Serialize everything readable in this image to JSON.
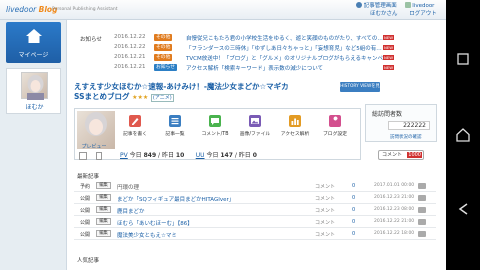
{
  "header": {
    "logo_brand": "livedoor",
    "logo_blog": "Blog",
    "tagline": "Personal Publishing Assistant",
    "link_settings": "記事管理画面",
    "link_livedoor": "livedoor",
    "user": "ほむかさん",
    "logout": "ログアウト"
  },
  "sidebar": {
    "mypage": "マイページ",
    "username": "ほむか"
  },
  "news": {
    "label": "お知らせ",
    "items": [
      {
        "date": "2016.12.22",
        "category": "その他",
        "cat_color": "#e07b1e",
        "text": "自慢従兄こもたろ君の小学校生活をゆるく、遊と笑顔のものがたり、すべての…",
        "is_new": true,
        "new_label": "NEW"
      },
      {
        "date": "2016.12.22",
        "category": "その他",
        "cat_color": "#e07b1e",
        "text": "「フランダースの三時休」「ゆずしあ日々ちゃっと」「妄想育児」など5組の有…",
        "is_new": true,
        "new_label": "NEW"
      },
      {
        "date": "2016.12.21",
        "category": "その他",
        "cat_color": "#e07b1e",
        "text": "TVCM放送中！「ブログ」と「グルメ」のオリジナルブログがもらえるキャンペ…",
        "is_new": true,
        "new_label": "NEW"
      },
      {
        "date": "2016.12.21",
        "category": "お知らせ",
        "cat_color": "#2c7fc5",
        "text": "アクセス解析「検索キーワード」表示数の減少について",
        "is_new": true,
        "new_label": "NEW"
      }
    ]
  },
  "blog": {
    "title_line1": "えすえす少女ほむか☆速報-あけみけ！-魔法少女まどか☆マギカ",
    "title_line2": "SSまとめブログ",
    "stars": "★★★",
    "anime_tag": "(アニメ)",
    "history_button": "HISTORY VIEWを見る",
    "preview": "プレビュー",
    "tools": [
      {
        "label": "記事を書く",
        "icon": "pencil-icon",
        "color": "#e0594e"
      },
      {
        "label": "記事一覧",
        "icon": "list-icon",
        "color": "#3b7ec1"
      },
      {
        "label": "コメント/TB",
        "icon": "comment-icon",
        "color": "#4ab34e"
      },
      {
        "label": "画像/ファイル",
        "icon": "image-icon",
        "color": "#7a5bb5"
      },
      {
        "label": "アクセス解析",
        "icon": "bar-chart-icon",
        "color": "#e39b24"
      },
      {
        "label": "ブログ設定",
        "icon": "wrench-icon",
        "color": "#d34f8e"
      }
    ],
    "pv_label": "PV",
    "pv_today_label": "今日",
    "pv_today": "849",
    "pv_yesterday_label": "/ 昨日",
    "pv_yesterday": "10",
    "uu_label": "UU",
    "uu_today_label": "今日",
    "uu_today": "147",
    "uu_yesterday_label": "/ 昨日",
    "uu_yesterday": "0",
    "comment_label": "コメント",
    "comment_count": "1000"
  },
  "pv_box": {
    "title": "総訪問者数",
    "value": "222222",
    "link": "訪問状況の確認"
  },
  "recent": {
    "label": "最新記事",
    "rows": [
      {
        "pub": "予約",
        "edit": "編集",
        "title": "円環の理",
        "status": "draft",
        "comment_label": "コメント",
        "comments": "0",
        "date": "2017.01.01 00:00"
      },
      {
        "pub": "公開",
        "edit": "編集",
        "title": "まどか「SQフィギュア最目まどかHITAGIver」",
        "status": "live",
        "comment_label": "コメント",
        "comments": "0",
        "date": "2016.12.23 21:00"
      },
      {
        "pub": "公開",
        "edit": "編集",
        "title": "鹿目まどか",
        "status": "live",
        "comment_label": "コメント",
        "comments": "0",
        "date": "2016.12.23 08:00"
      },
      {
        "pub": "公開",
        "edit": "編集",
        "title": "ほむら「あいむほーむ」【86】",
        "status": "live",
        "comment_label": "コメント",
        "comments": "0",
        "date": "2016.12.22 21:00"
      },
      {
        "pub": "公開",
        "edit": "編集",
        "title": "魔法美少女ともえ☆マミ",
        "status": "live",
        "comment_label": "コメント",
        "comments": "0",
        "date": "2016.12.22 18:00"
      }
    ]
  },
  "popular": {
    "label": "人気記事"
  }
}
